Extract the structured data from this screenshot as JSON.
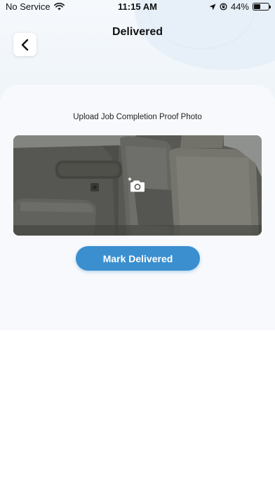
{
  "status_bar": {
    "carrier": "No Service",
    "time": "11:15 AM",
    "battery": "44%",
    "battery_level": 0.44
  },
  "header": {
    "title": "Delivered",
    "back_icon": "chevron-left-icon"
  },
  "upload": {
    "label": "Upload Job Completion Proof Photo",
    "camera_icon": "add-photo-camera-icon"
  },
  "actions": {
    "mark_delivered_label": "Mark Delivered"
  },
  "colors": {
    "primary": "#3b8fcf",
    "card_bg": "#f7f9fc",
    "header_bg": "#eef4f9"
  }
}
